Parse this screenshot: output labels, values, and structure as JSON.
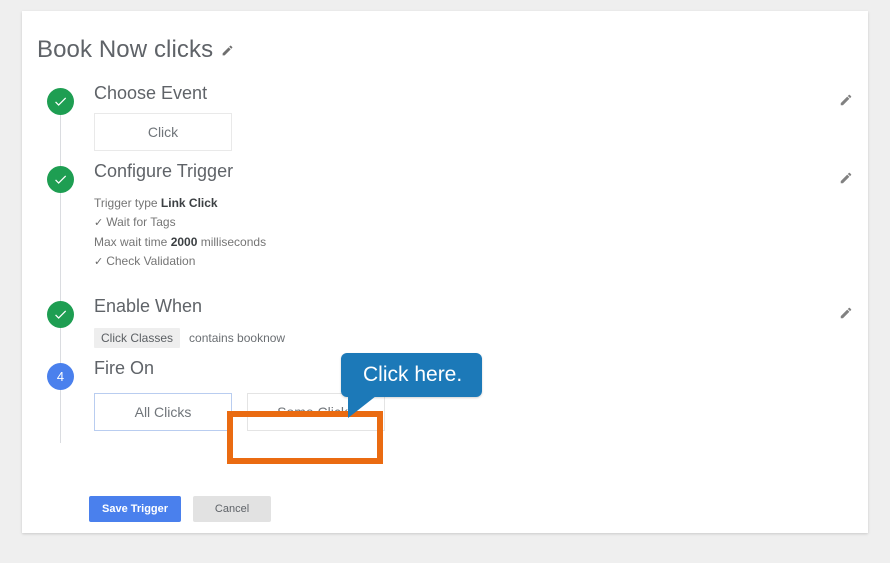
{
  "page": {
    "background_color": "#efefef"
  },
  "card": {
    "title": "Book Now clicks",
    "title_edit_icon": "pencil-icon"
  },
  "steps": [
    {
      "index": 1,
      "state": "done",
      "bullet_glyph": "check-icon",
      "heading": "Choose Event",
      "edit_icon": "pencil-icon",
      "choices": [
        {
          "label": "Click",
          "selected": false
        }
      ]
    },
    {
      "index": 2,
      "state": "done",
      "bullet_glyph": "check-icon",
      "heading": "Configure Trigger",
      "edit_icon": "pencil-icon",
      "details": [
        {
          "check": false,
          "label": "Trigger type ",
          "strong": "Link Click",
          "suffix": ""
        },
        {
          "check": true,
          "label": "Wait for Tags",
          "strong": "",
          "suffix": ""
        },
        {
          "check": false,
          "label": "Max wait time ",
          "strong": "2000",
          "suffix": " milliseconds"
        },
        {
          "check": true,
          "label": "Check Validation",
          "strong": "",
          "suffix": ""
        }
      ]
    },
    {
      "index": 3,
      "state": "done",
      "bullet_glyph": "check-icon",
      "heading": "Enable When",
      "edit_icon": "pencil-icon",
      "condition": {
        "chip": "Click Classes",
        "operator_and_value": "contains booknow"
      }
    },
    {
      "index": 4,
      "state": "active",
      "bullet_glyph": "4",
      "heading": "Fire On",
      "edit_icon": null,
      "choices": [
        {
          "label": "All Clicks",
          "selected": true
        },
        {
          "label": "Some Clicks",
          "selected": false
        }
      ]
    }
  ],
  "actions": {
    "save_label": "Save Trigger",
    "cancel_label": "Cancel"
  },
  "annotation": {
    "callout_text": "Click here.",
    "callout_color": "#1c79b8",
    "highlight_color": "#ea6b11",
    "highlight_target": "Some Clicks"
  },
  "colors": {
    "done_bullet": "#1e9e52",
    "active_bullet": "#4a80ed",
    "primary_button": "#4a80ed",
    "heading_text": "#5f6368"
  }
}
